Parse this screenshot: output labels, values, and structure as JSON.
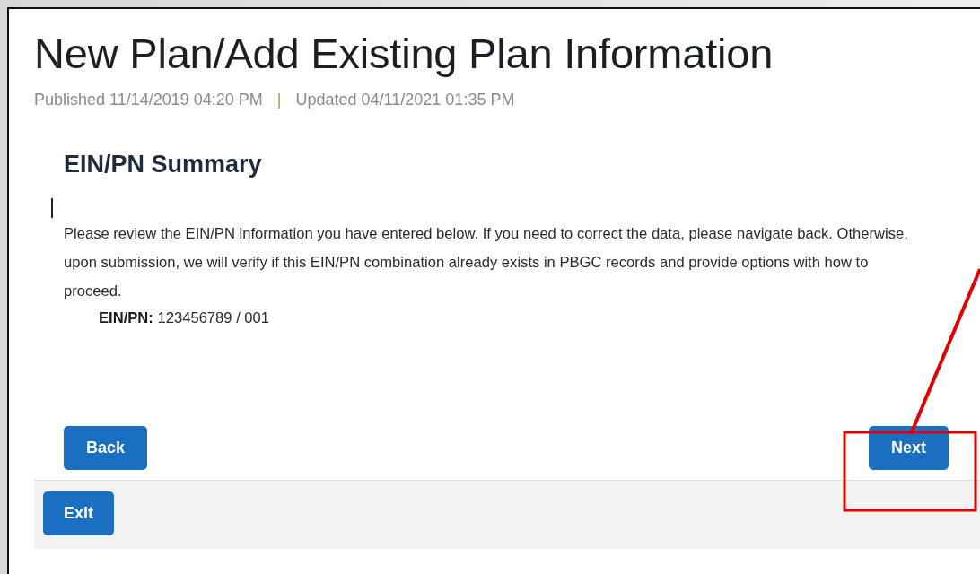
{
  "title": "New Plan/Add Existing Plan Information",
  "meta": {
    "published": "Published 11/14/2019 04:20 PM",
    "separator": "|",
    "updated": "Updated 04/11/2021 01:35 PM"
  },
  "section": {
    "heading": "EIN/PN Summary",
    "paragraph": "Please review the EIN/PN information you have entered below. If you need to correct the data, please navigate back. Otherwise, upon submission, we will verify if this EIN/PN combination already exists in PBGC records and provide options with how to proceed.",
    "field": {
      "label": "EIN/PN:",
      "value": "123456789 / 001"
    }
  },
  "buttons": [
    {
      "label": "Back"
    },
    {
      "label": "Next"
    }
  ],
  "footer": {
    "buttons": [
      {
        "label": "Exit"
      }
    ]
  }
}
